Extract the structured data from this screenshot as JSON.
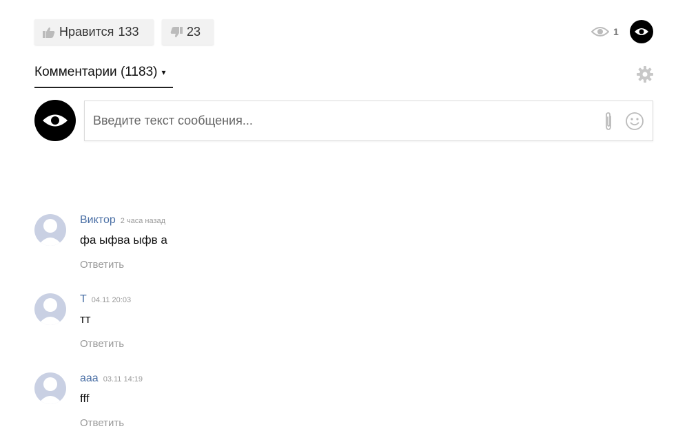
{
  "votes": {
    "like_label": "Нравится",
    "like_count": "133",
    "dislike_count": "23"
  },
  "viewers": {
    "count": "1"
  },
  "comments": {
    "tab_label": "Комментарии (1183)",
    "caret": "▾"
  },
  "composer": {
    "placeholder": "Введите текст сообщения..."
  },
  "comment_list": [
    {
      "author": "Виктор",
      "time": "2 часа назад",
      "text": "фа ыфва ыфв а",
      "reply": "Ответить"
    },
    {
      "author": "Т",
      "time": "04.11 20:03",
      "text": "тт",
      "reply": "Ответить"
    },
    {
      "author": "ааа",
      "time": "03.11 14:19",
      "text": "fff",
      "reply": "Ответить"
    }
  ],
  "icons": {
    "like": "thumbs-up-icon",
    "dislike": "thumbs-down-icon",
    "viewers": "eye-icon",
    "settings": "gear-icon",
    "attach": "paperclip-icon",
    "emoji": "smile-icon"
  },
  "colors": {
    "author_link": "#4a6fa5",
    "muted": "#999999",
    "avatar_placeholder": "#c9d0e3"
  }
}
